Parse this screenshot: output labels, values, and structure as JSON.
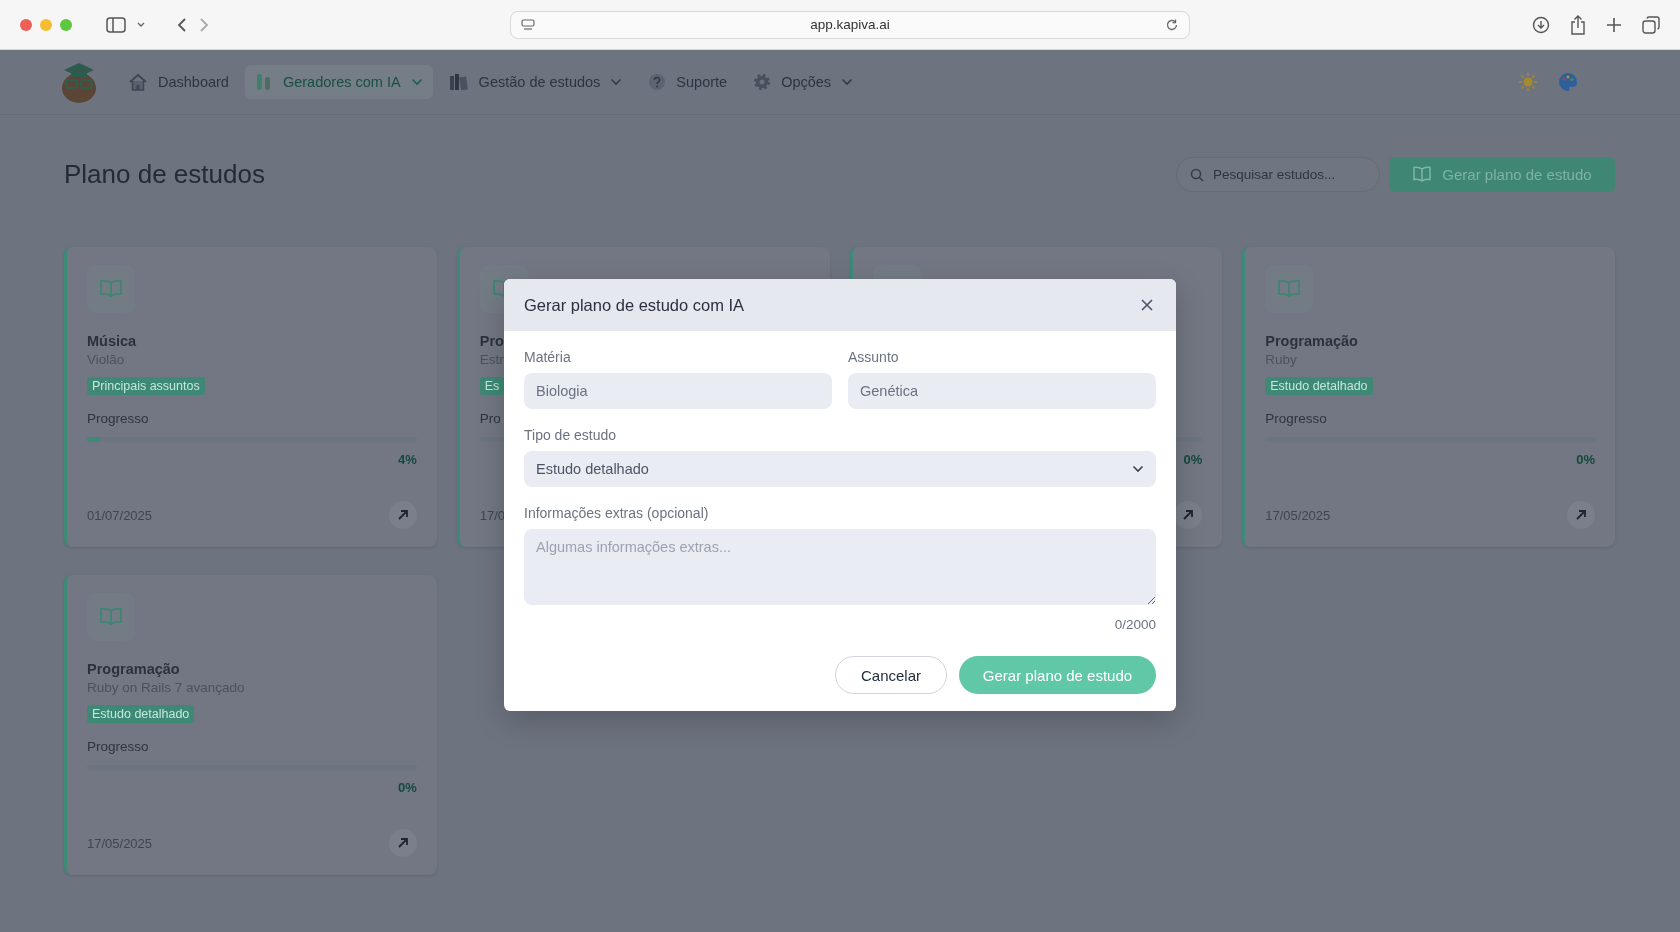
{
  "browser": {
    "url": "app.kapiva.ai"
  },
  "nav": {
    "items": [
      {
        "label": "Dashboard",
        "selected": false,
        "dropdown": false
      },
      {
        "label": "Geradores com IA",
        "selected": true,
        "dropdown": true
      },
      {
        "label": "Gestão de estudos",
        "selected": false,
        "dropdown": true
      },
      {
        "label": "Suporte",
        "selected": false,
        "dropdown": false
      },
      {
        "label": "Opções",
        "selected": false,
        "dropdown": true
      }
    ]
  },
  "page": {
    "title": "Plano de estudos",
    "search": {
      "placeholder": "Pesquisar estudos..."
    },
    "generate_button": "Gerar plano de estudo"
  },
  "cards": [
    {
      "title": "Música",
      "subtitle": "Violão",
      "tag": "Principais assuntos",
      "progress_label": "Progresso",
      "level": 0.04,
      "percent": "4%",
      "date": "01/07/2025",
      "open_button": true
    },
    {
      "title": "Pro",
      "subtitle": "Estr",
      "tag": "Es",
      "progress_label": "Pro",
      "level": 0,
      "date": "17/0",
      "open_button": false
    },
    {
      "level": 0,
      "percent": "0%",
      "open_button": true
    },
    {
      "title": "Programação",
      "subtitle": "Ruby",
      "tag": "Estudo detalhado",
      "progress_label": "Progresso",
      "level": 0,
      "percent": "0%",
      "date": "17/05/2025",
      "open_button": true
    },
    {
      "title": "Programação",
      "subtitle": "Ruby on Rails 7 avançado",
      "tag": "Estudo detalhado",
      "progress_label": "Progresso",
      "level": 0,
      "percent": "0%",
      "date": "17/05/2025",
      "open_button": true
    }
  ],
  "modal": {
    "title": "Gerar plano de estudo com IA",
    "fields": [
      {
        "label": "Matéria",
        "placeholder": "Biologia"
      },
      {
        "label": "Assunto",
        "placeholder": "Genética"
      }
    ],
    "study_type": {
      "label": "Tipo de estudo",
      "value": "Estudo detalhado"
    },
    "extras": {
      "label": "Informações extras (opcional)",
      "placeholder": "Algumas informações extras...",
      "counter": "0/2000"
    },
    "buttons": {
      "cancel": "Cancelar",
      "submit": "Gerar plano de estudo"
    }
  }
}
